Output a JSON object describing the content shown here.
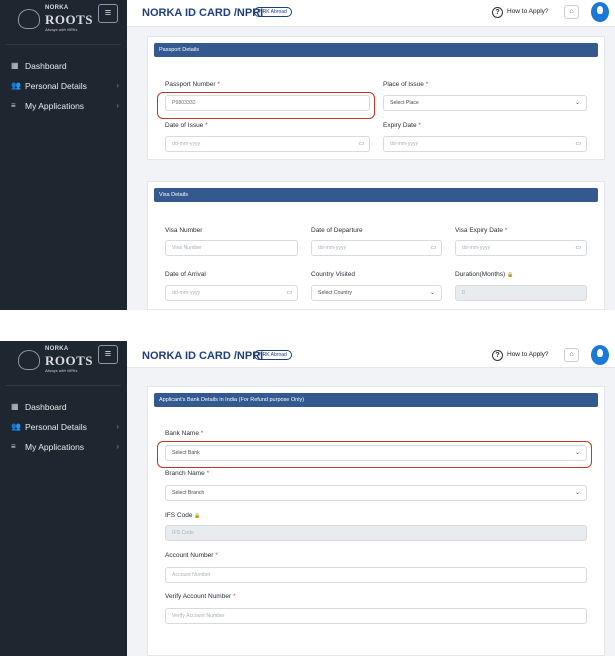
{
  "app": {
    "logo_brand": "NORKA",
    "logo_name": "ROOTS",
    "logo_tagline": "Always with NRKs",
    "menu_icon": "≡"
  },
  "sidebar": {
    "items": [
      {
        "label": "Dashboard",
        "icon": "▦",
        "has_chevron": false
      },
      {
        "label": "Personal Details",
        "icon": "👥",
        "has_chevron": true
      },
      {
        "label": "My Applications",
        "icon": "≡",
        "has_chevron": true
      }
    ],
    "chevron": "›"
  },
  "header": {
    "title": "NORKA ID CARD /NPRI",
    "badge": "NRK Abroad",
    "help_icon": "?",
    "help_label": "How to Apply?",
    "home_icon": "⌂"
  },
  "icons": {
    "calendar": "▭",
    "chevron_down": "⌄",
    "lock": "🔒"
  },
  "screen1": {
    "passport": {
      "header": "Passport Details",
      "passport_number": {
        "label": "Passport Number",
        "required": "*",
        "value": "P9803332"
      },
      "place_of_issue": {
        "label": "Place of Issue",
        "required": "*",
        "value": "Select Place"
      },
      "date_of_issue": {
        "label": "Date of Issue",
        "required": "*",
        "placeholder": "dd-mm-yyyy"
      },
      "expiry_date": {
        "label": "Expiry Date",
        "required": "*",
        "placeholder": "dd-mm-yyyy"
      }
    },
    "visa": {
      "header": "Visa Details",
      "visa_number": {
        "label": "Visa Number",
        "placeholder": "Visa Number"
      },
      "date_of_departure": {
        "label": "Date of Departure",
        "placeholder": "dd-mm-yyyy"
      },
      "visa_expiry_date": {
        "label": "Visa Expiry Date",
        "required": "*",
        "placeholder": "dd-mm-yyyy"
      },
      "date_of_arrival": {
        "label": "Date of Arrival",
        "placeholder": "dd-mm-yyyy"
      },
      "country_visited": {
        "label": "Country Visited",
        "value": "Select Country"
      },
      "duration": {
        "label": "Duration(Months)",
        "value": "0"
      }
    }
  },
  "screen2": {
    "bank": {
      "header": "Applicant's Bank Details in India (For Refund purpose Only)",
      "bank_name": {
        "label": "Bank Name",
        "required": "*",
        "value": "Select Bank"
      },
      "branch_name": {
        "label": "Branch Name",
        "required": "*",
        "value": "Select Branch"
      },
      "ifs_code": {
        "label": "IFS Code",
        "placeholder": "IFS Code"
      },
      "account_number": {
        "label": "Account Number",
        "required": "*",
        "placeholder": "Account Number"
      },
      "verify_account_number": {
        "label": "Verify Account Number",
        "required": "*",
        "placeholder": "Verify Account Number"
      }
    }
  }
}
